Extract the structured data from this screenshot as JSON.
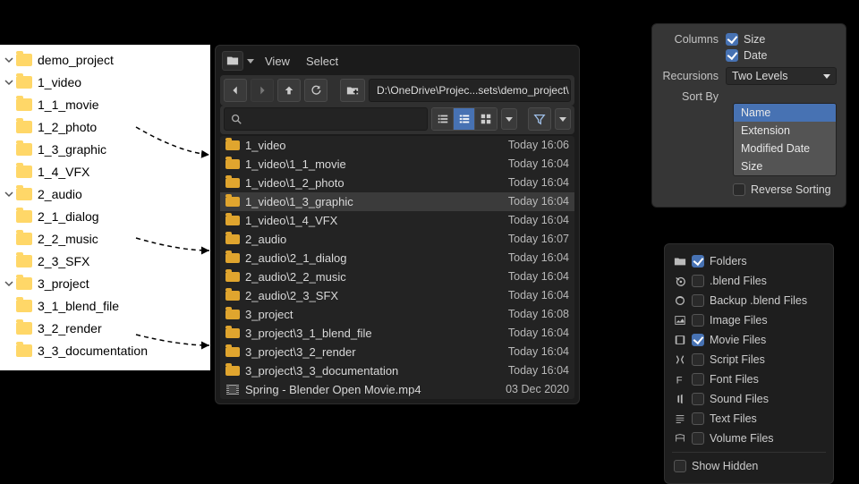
{
  "wintree": {
    "root": "demo_project",
    "groups": [
      {
        "name": "1_video",
        "children": [
          "1_1_movie",
          "1_2_photo",
          "1_3_graphic",
          "1_4_VFX"
        ]
      },
      {
        "name": "2_audio",
        "children": [
          "2_1_dialog",
          "2_2_music",
          "2_3_SFX"
        ]
      },
      {
        "name": "3_project",
        "children": [
          "3_1_blend_file",
          "3_2_render",
          "3_3_documentation"
        ]
      }
    ]
  },
  "filebrowser": {
    "menus": {
      "view": "View",
      "select": "Select"
    },
    "path": "D:\\OneDrive\\Projec...sets\\demo_project\\",
    "rows": [
      {
        "t": "folder",
        "name": "1_video",
        "date": "Today 16:06"
      },
      {
        "t": "folder",
        "name": "1_video\\1_1_movie",
        "date": "Today 16:04"
      },
      {
        "t": "folder",
        "name": "1_video\\1_2_photo",
        "date": "Today 16:04"
      },
      {
        "t": "folder",
        "name": "1_video\\1_3_graphic",
        "date": "Today 16:04",
        "sel": true
      },
      {
        "t": "folder",
        "name": "1_video\\1_4_VFX",
        "date": "Today 16:04"
      },
      {
        "t": "folder",
        "name": "2_audio",
        "date": "Today 16:07"
      },
      {
        "t": "folder",
        "name": "2_audio\\2_1_dialog",
        "date": "Today 16:04"
      },
      {
        "t": "folder",
        "name": "2_audio\\2_2_music",
        "date": "Today 16:04"
      },
      {
        "t": "folder",
        "name": "2_audio\\2_3_SFX",
        "date": "Today 16:04"
      },
      {
        "t": "folder",
        "name": "3_project",
        "date": "Today 16:08"
      },
      {
        "t": "folder",
        "name": "3_project\\3_1_blend_file",
        "date": "Today 16:04"
      },
      {
        "t": "folder",
        "name": "3_project\\3_2_render",
        "date": "Today 16:04"
      },
      {
        "t": "folder",
        "name": "3_project\\3_3_documentation",
        "date": "Today 16:04"
      },
      {
        "t": "movie",
        "name": "Spring - Blender Open Movie.mp4",
        "date": "03 Dec 2020"
      }
    ]
  },
  "options": {
    "columns_label": "Columns",
    "col_size": "Size",
    "col_date": "Date",
    "recursions_label": "Recursions",
    "recursions_value": "Two Levels",
    "sortby_label": "Sort By",
    "sort_items": [
      "Name",
      "Extension",
      "Modified Date",
      "Size"
    ],
    "sort_active": "Name",
    "reverse_label": "Reverse Sorting"
  },
  "filters": {
    "items": [
      {
        "icon": "folder",
        "label": "Folders",
        "on": true
      },
      {
        "icon": "blend",
        "label": ".blend Files",
        "on": false
      },
      {
        "icon": "backup",
        "label": "Backup .blend Files",
        "on": false
      },
      {
        "icon": "image",
        "label": "Image Files",
        "on": false
      },
      {
        "icon": "movie",
        "label": "Movie Files",
        "on": true
      },
      {
        "icon": "script",
        "label": "Script Files",
        "on": false
      },
      {
        "icon": "font",
        "label": "Font Files",
        "on": false
      },
      {
        "icon": "sound",
        "label": "Sound Files",
        "on": false
      },
      {
        "icon": "text",
        "label": "Text Files",
        "on": false
      },
      {
        "icon": "volume",
        "label": "Volume Files",
        "on": false
      }
    ],
    "show_hidden": "Show Hidden"
  }
}
